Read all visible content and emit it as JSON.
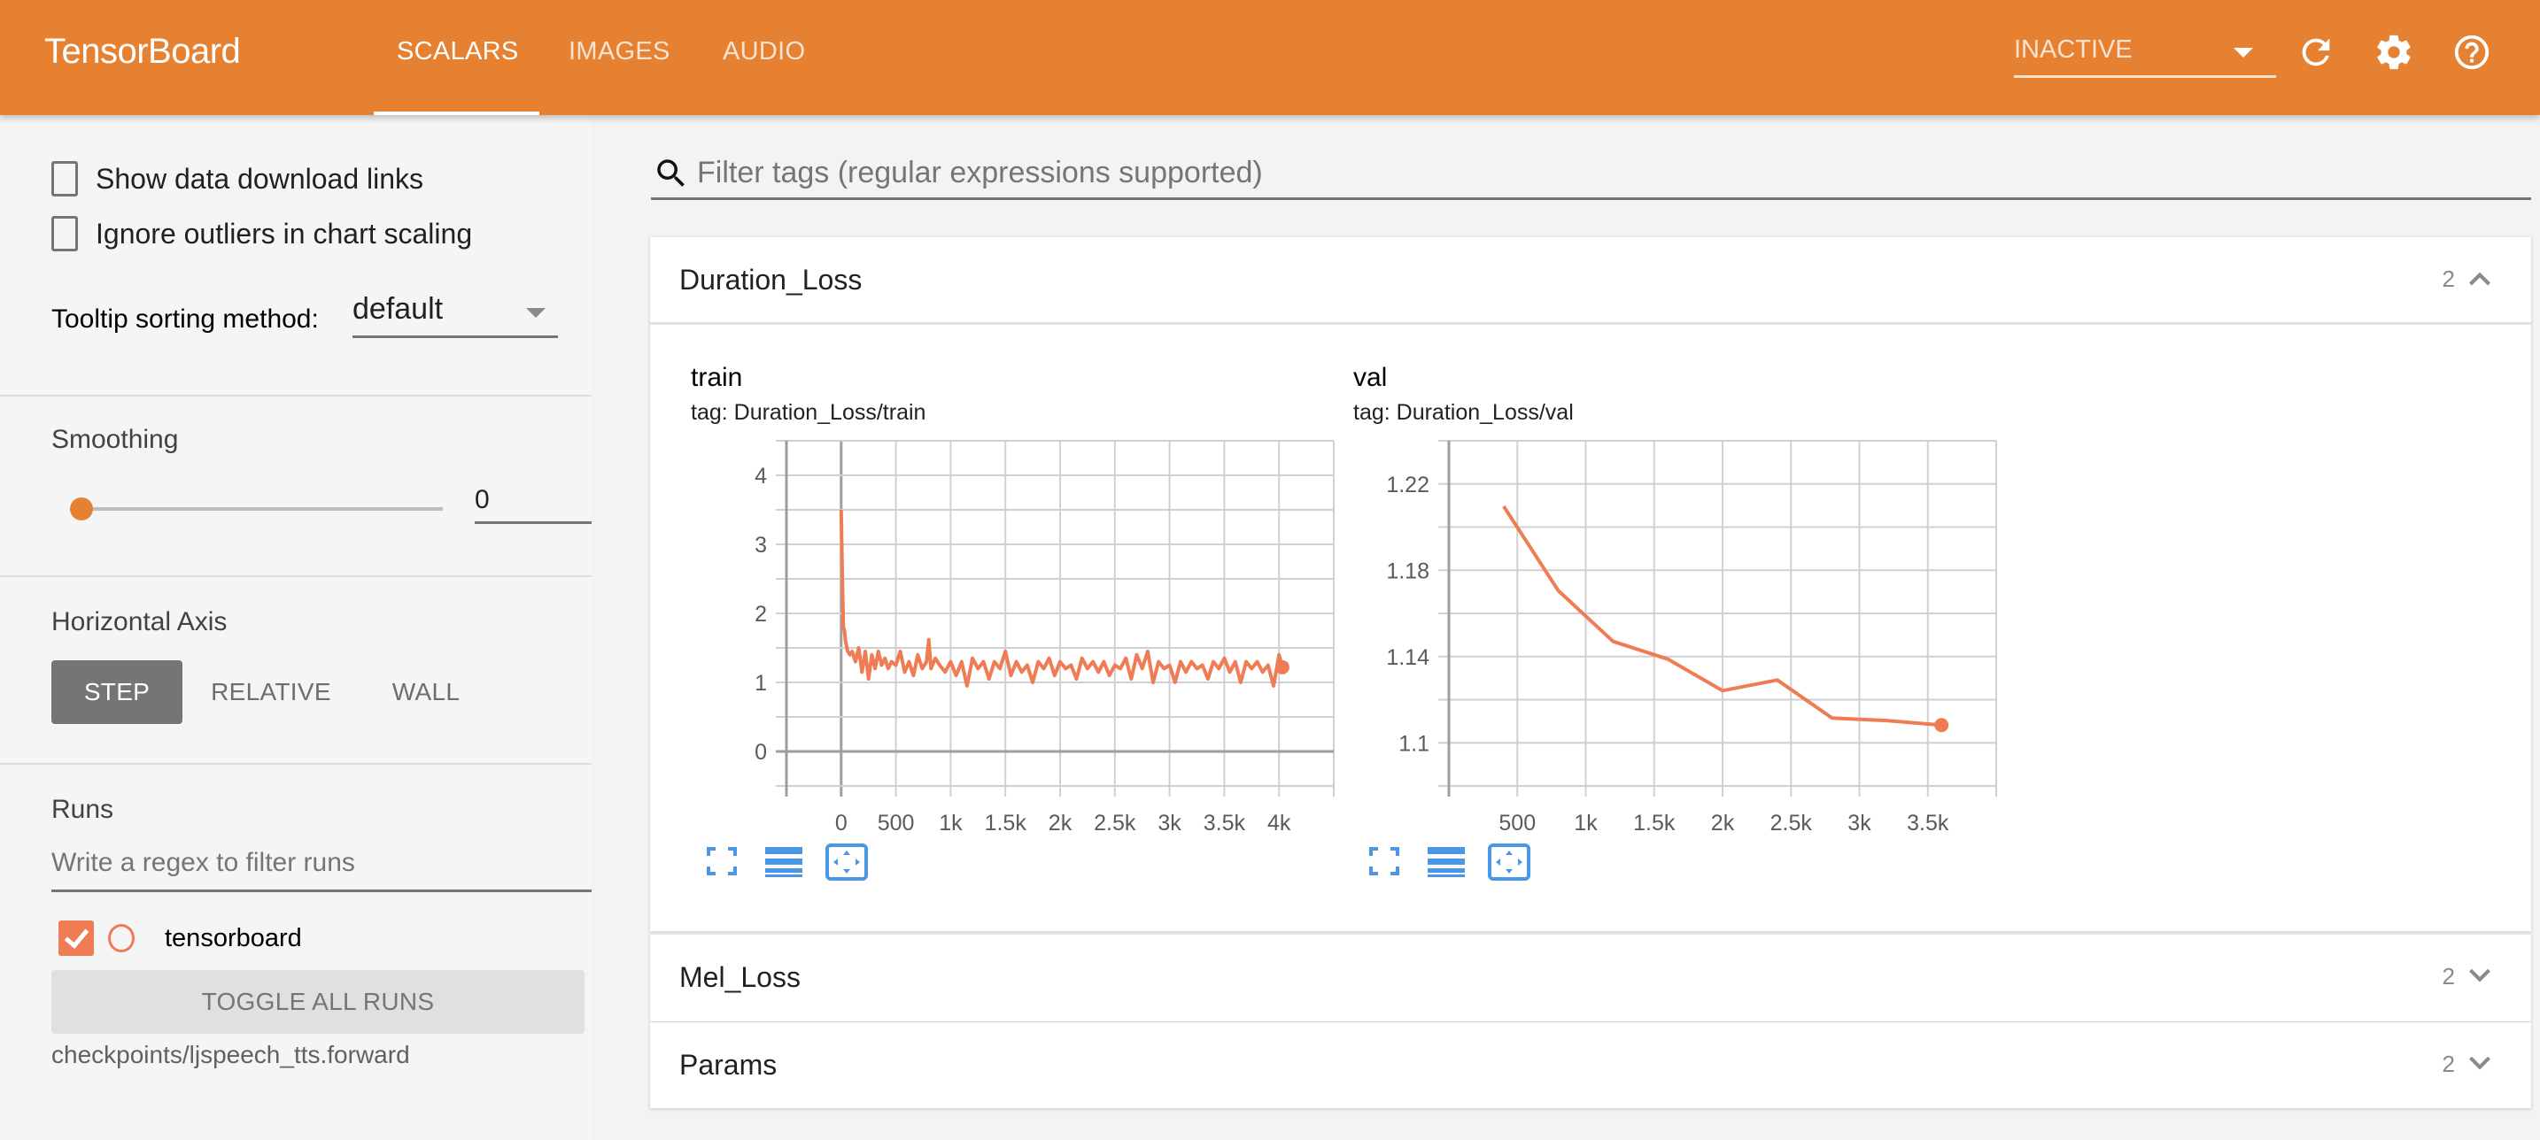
{
  "header": {
    "brand": "TensorBoard",
    "tabs": [
      {
        "label": "SCALARS",
        "active": true
      },
      {
        "label": "IMAGES",
        "active": false
      },
      {
        "label": "AUDIO",
        "active": false
      }
    ],
    "run_status_select": "INACTIVE",
    "icons": [
      "refresh-icon",
      "settings-gear-icon",
      "help-icon"
    ],
    "brand_color": "#e68131"
  },
  "sidebar": {
    "show_download_links": {
      "label": "Show data download links",
      "checked": false
    },
    "ignore_outliers": {
      "label": "Ignore outliers in chart scaling",
      "checked": false
    },
    "tooltip_sorting": {
      "label": "Tooltip sorting method:",
      "value": "default"
    },
    "smoothing": {
      "label": "Smoothing",
      "value": "0",
      "slider_fraction": 0
    },
    "horizontal_axis": {
      "label": "Horizontal Axis",
      "options": [
        "STEP",
        "RELATIVE",
        "WALL"
      ],
      "selected": "STEP"
    },
    "runs": {
      "label": "Runs",
      "filter_placeholder": "Write a regex to filter runs",
      "items": [
        {
          "name": "tensorboard",
          "checked": true,
          "color": "#ef7c54"
        }
      ],
      "toggle_all_label": "TOGGLE ALL RUNS",
      "logdir": "checkpoints/ljspeech_tts.forward"
    }
  },
  "main": {
    "filter_placeholder": "Filter tags (regular expressions supported)",
    "groups": [
      {
        "name": "Duration_Loss",
        "count": "2",
        "expanded": true
      },
      {
        "name": "Mel_Loss",
        "count": "2",
        "expanded": false
      },
      {
        "name": "Params",
        "count": "2",
        "expanded": false
      }
    ],
    "chart_tools": [
      "fullscreen-icon",
      "toggle-log-scale-icon",
      "fit-domain-icon"
    ]
  },
  "chart_data": [
    {
      "type": "line",
      "title": "train",
      "subtitle": "tag: Duration_Loss/train",
      "xlabel": "",
      "ylabel": "",
      "xlim": [
        -500,
        4500
      ],
      "ylim": [
        -0.5,
        4.5
      ],
      "xticks": [
        0,
        500,
        1000,
        1500,
        2000,
        2500,
        3000,
        3500,
        4000
      ],
      "xtick_labels": [
        "0",
        "500",
        "1k",
        "1.5k",
        "2k",
        "2.5k",
        "3k",
        "3.5k",
        "4k"
      ],
      "yticks": [
        0,
        1,
        2,
        3,
        4
      ],
      "ytick_labels": [
        "0",
        "1",
        "2",
        "3",
        "4"
      ],
      "grid": true,
      "series": [
        {
          "name": "tensorboard",
          "color": "#ef7c54",
          "x": [
            0,
            10,
            20,
            30,
            40,
            60,
            80,
            100,
            130,
            160,
            190,
            220,
            250,
            280,
            310,
            340,
            370,
            400,
            430,
            460,
            500,
            540,
            580,
            620,
            660,
            700,
            740,
            780,
            800,
            820,
            860,
            900,
            950,
            1000,
            1050,
            1100,
            1150,
            1200,
            1250,
            1300,
            1350,
            1400,
            1450,
            1500,
            1550,
            1600,
            1650,
            1700,
            1750,
            1800,
            1850,
            1900,
            1950,
            2000,
            2050,
            2100,
            2150,
            2200,
            2250,
            2300,
            2350,
            2400,
            2450,
            2500,
            2550,
            2600,
            2650,
            2700,
            2750,
            2800,
            2850,
            2900,
            2950,
            3000,
            3050,
            3100,
            3150,
            3200,
            3250,
            3300,
            3350,
            3400,
            3450,
            3500,
            3550,
            3600,
            3650,
            3700,
            3750,
            3800,
            3850,
            3900,
            3950,
            4000,
            4030
          ],
          "y": [
            3.5,
            2.6,
            1.8,
            1.75,
            1.6,
            1.45,
            1.4,
            1.45,
            1.3,
            1.5,
            1.15,
            1.45,
            1.05,
            1.4,
            1.2,
            1.45,
            1.25,
            1.35,
            1.2,
            1.3,
            1.25,
            1.45,
            1.15,
            1.3,
            1.1,
            1.4,
            1.2,
            1.3,
            1.62,
            1.2,
            1.35,
            1.25,
            1.15,
            1.3,
            1.1,
            1.3,
            0.95,
            1.35,
            1.2,
            1.3,
            1.05,
            1.3,
            1.2,
            1.45,
            1.1,
            1.3,
            1.15,
            1.25,
            1.0,
            1.3,
            1.2,
            1.35,
            1.1,
            1.3,
            1.2,
            1.25,
            1.05,
            1.35,
            1.2,
            1.3,
            1.15,
            1.3,
            1.1,
            1.25,
            1.2,
            1.35,
            1.05,
            1.4,
            1.2,
            1.45,
            1.0,
            1.3,
            1.2,
            1.25,
            1.0,
            1.3,
            1.15,
            1.3,
            1.2,
            1.25,
            1.05,
            1.3,
            1.2,
            1.35,
            1.15,
            1.3,
            1.0,
            1.3,
            1.2,
            1.3,
            1.15,
            1.25,
            0.95,
            1.4,
            1.22
          ]
        }
      ]
    },
    {
      "type": "line",
      "title": "val",
      "subtitle": "tag: Duration_Loss/val",
      "xlabel": "",
      "ylabel": "",
      "xlim": [
        0,
        4000
      ],
      "ylim": [
        1.08,
        1.24
      ],
      "xticks": [
        500,
        1000,
        1500,
        2000,
        2500,
        3000,
        3500
      ],
      "xtick_labels": [
        "500",
        "1k",
        "1.5k",
        "2k",
        "2.5k",
        "3k",
        "3.5k"
      ],
      "yticks": [
        1.1,
        1.14,
        1.18,
        1.22
      ],
      "ytick_labels": [
        "1.1",
        "1.14",
        "1.18",
        "1.22"
      ],
      "grid": true,
      "series": [
        {
          "name": "tensorboard",
          "color": "#ef7c54",
          "x": [
            400,
            800,
            1200,
            1600,
            2000,
            2400,
            2800,
            3200,
            3600
          ],
          "y": [
            1.2097,
            1.1705,
            1.147,
            1.1388,
            1.1242,
            1.1291,
            1.1115,
            1.1103,
            1.1082
          ]
        }
      ]
    }
  ]
}
